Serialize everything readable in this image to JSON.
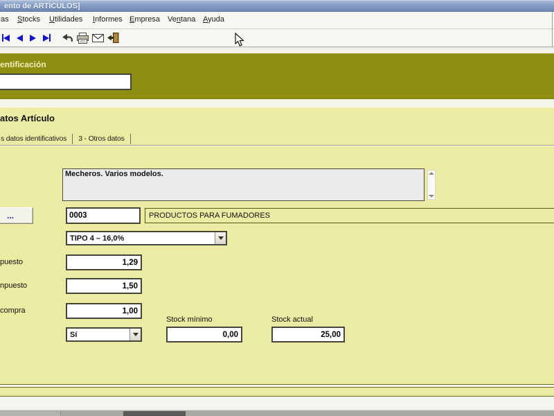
{
  "colors": {
    "titlebar_blue": "#7f97c0",
    "olive_panel": "#8e8e12",
    "pale_yellow": "#ebeba3",
    "nav_icon_blue": "#1414c8",
    "field_border": "#45453c"
  },
  "window": {
    "title": "ento de ARTÍCULOS]"
  },
  "menu": {
    "items": [
      {
        "pre": "as",
        "key": "",
        "post": ""
      },
      {
        "pre": "",
        "key": "S",
        "post": "tocks"
      },
      {
        "pre": "",
        "key": "U",
        "post": "tilidades"
      },
      {
        "pre": "",
        "key": "I",
        "post": "nformes"
      },
      {
        "pre": "",
        "key": "E",
        "post": "mpresa"
      },
      {
        "pre": "Ve",
        "key": "n",
        "post": "tana"
      },
      {
        "pre": "",
        "key": "A",
        "post": "yuda"
      }
    ]
  },
  "toolbar": {
    "icons": [
      "first-record",
      "previous-record",
      "next-record",
      "last-record",
      "undo",
      "print",
      "email",
      "exit"
    ]
  },
  "identification": {
    "section_title": "entificación",
    "code_value": ""
  },
  "article": {
    "section_title": "atos Artículo",
    "tabs": [
      {
        "label": "s datos identificativos"
      },
      {
        "label": "3 - Otros datos"
      }
    ],
    "description": "Mecheros. Varios modelos.",
    "lookup_button_label": "...",
    "code": "0003",
    "family": "PRODUCTOS PARA FUMADORES",
    "tax_type": "TIPO 4 – 16,0%",
    "prices": [
      {
        "label": "puesto",
        "value": "1,29"
      },
      {
        "label": "npuesto",
        "value": "1,50"
      },
      {
        "label": "compra",
        "value": "1,00"
      }
    ],
    "sellable": "Sí",
    "stock_min_label": "Stock mínimo",
    "stock_min_value": "0,00",
    "stock_actual_label": "Stock actual",
    "stock_actual_value": "25,00"
  }
}
